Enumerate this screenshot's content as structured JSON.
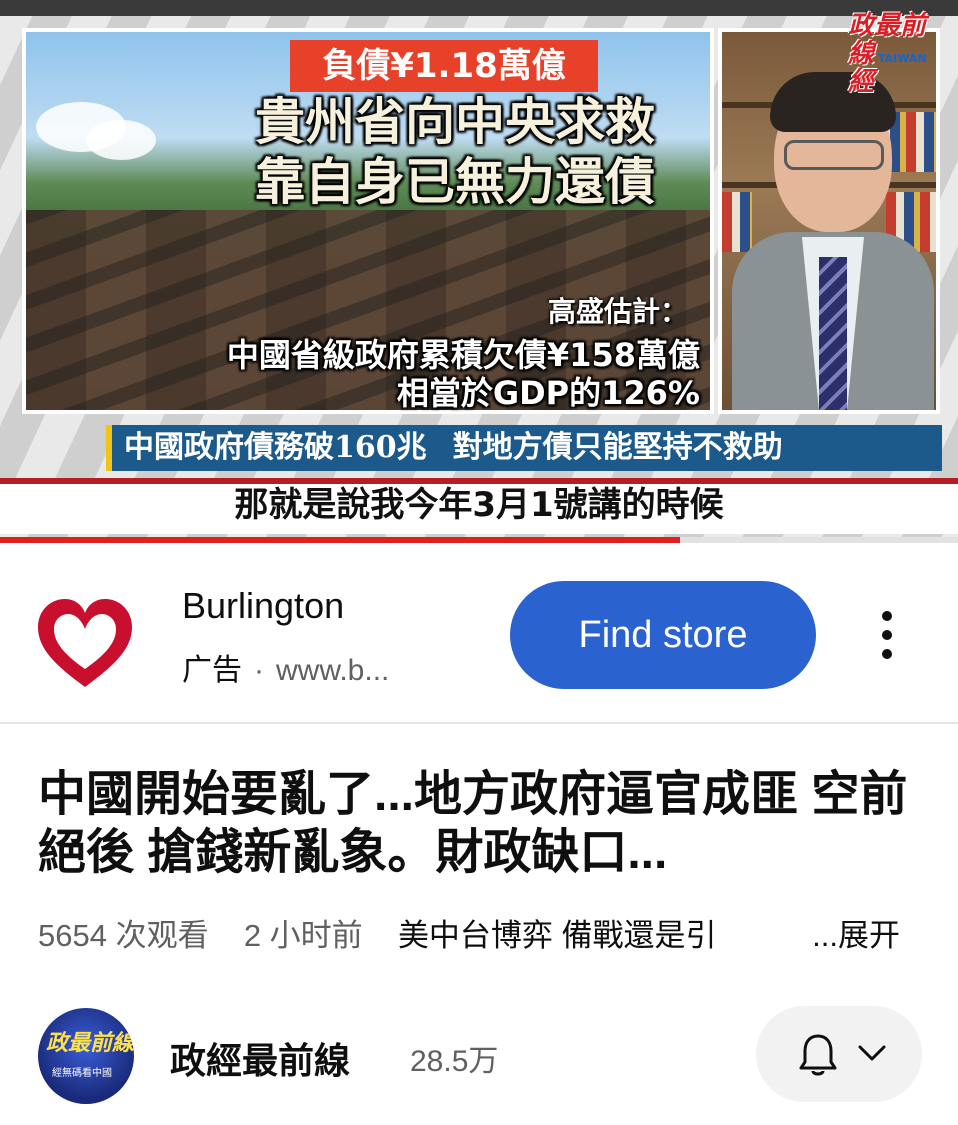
{
  "video": {
    "thumbnail": {
      "debt_tag": "負債¥1.18萬億",
      "headline_line1": "貴州省向中央求救",
      "headline_line2": "靠自身已無力還債",
      "estimate_title": "高盛估計：",
      "estimate_line1": "中國省級政府累積欠債¥158萬億",
      "estimate_line2": "相當於GDP的126%",
      "channel_logo_line1": "政最前線",
      "channel_logo_line2": "經",
      "channel_logo_sub": "TAIWAN"
    },
    "ticker_part1": "中國政府債務破160兆",
    "ticker_part2": "對地方債只能堅持不救助",
    "subtitle": "那就是說我今年3月1號講的時候",
    "progress_fraction": 0.71
  },
  "ad": {
    "advertiser": "Burlington",
    "label": "广告",
    "separator": "·",
    "url": "www.b...",
    "cta": "Find store",
    "brand_color": "#c8102e"
  },
  "video_info": {
    "title": "中國開始要亂了...地方政府逼官成匪 空前絕後 搶錢新亂象。財政缺口...",
    "views": "5654 次观看",
    "time_ago": "2 小时前",
    "tags": "美中台博弈 備戰還是引",
    "expand": "...展开"
  },
  "channel": {
    "name": "政經最前線",
    "subscribers": "28.5万",
    "avatar_line1": "政最前線",
    "avatar_line2": "經無碼看中國"
  },
  "colors": {
    "cta_blue": "#2a62d0",
    "ticker_blue": "#1d5a8c",
    "progress_red": "#e02020"
  }
}
